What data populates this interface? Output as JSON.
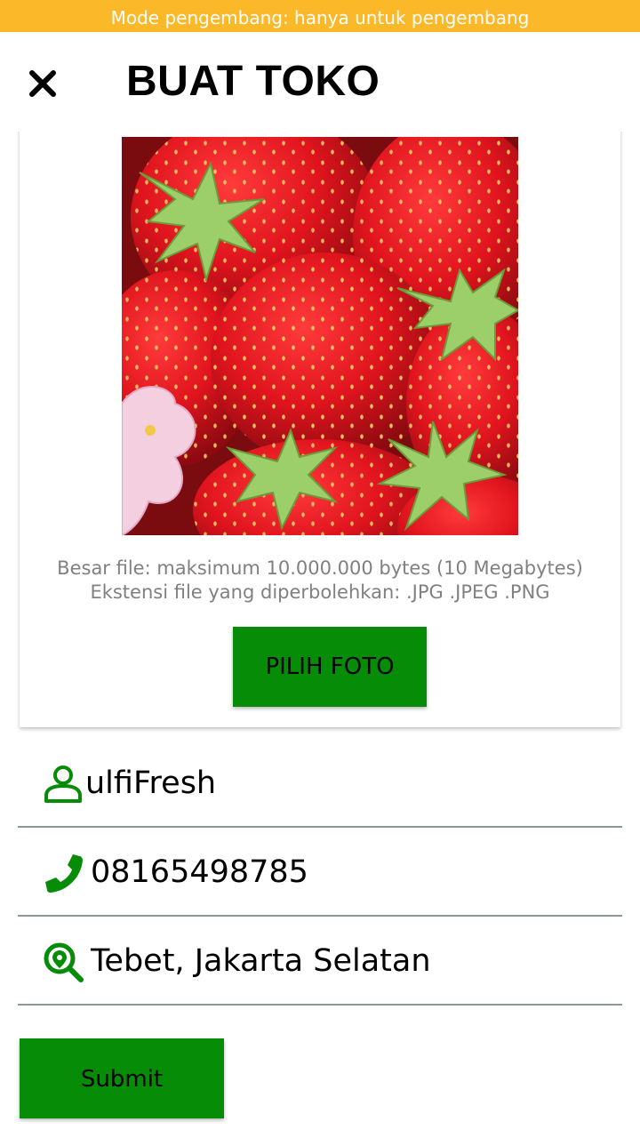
{
  "status_bar": {
    "dev_mode_text": "Mode pengembang: hanya untuk pengembang"
  },
  "header": {
    "title": "BUAT TOKO",
    "close_icon": "close-icon"
  },
  "photo_section": {
    "image_subject": "strawberries",
    "file_size_info": "Besar file: maksimum 10.000.000 bytes (10 Megabytes)",
    "allowed_ext_info": "Ekstensi file yang diperbolehkan: .JPG .JPEG .PNG",
    "pick_photo_label": "PILIH FOTO"
  },
  "form": {
    "store_name": {
      "icon": "user-icon",
      "value": "ulfiFresh"
    },
    "phone": {
      "icon": "phone-icon",
      "value": "08165498785"
    },
    "location": {
      "icon": "location-search-icon",
      "value": "Tebet, Jakarta Selatan"
    }
  },
  "submit_label": "Submit",
  "colors": {
    "dev_banner": "#fbb829",
    "accent_green": "#068c06",
    "divider": "#8a979c",
    "hint_text": "#808080"
  }
}
